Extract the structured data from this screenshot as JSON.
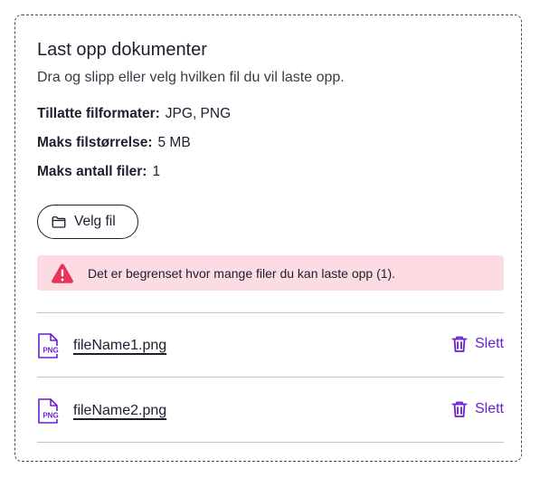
{
  "uploader": {
    "title": "Last opp dokumenter",
    "description": "Dra og slipp eller velg hvilken fil du vil laste opp.",
    "allowed_formats_label": "Tillatte filformater:",
    "allowed_formats_value": "JPG, PNG",
    "max_size_label": "Maks filstørrelse:",
    "max_size_value": "5 MB",
    "max_files_label": "Maks antall filer:",
    "max_files_value": "1",
    "choose_button_label": "Velg fil",
    "alert_message": "Det er begrenset hvor mange filer du kan laste opp (1).",
    "files": [
      {
        "name": "fileName1.png",
        "type_badge": "PNG",
        "delete_label": "Slett"
      },
      {
        "name": "fileName2.png",
        "type_badge": "PNG",
        "delete_label": "Slett"
      }
    ]
  },
  "icons": {
    "choose_button": "folder-icon",
    "alert": "warning-triangle-icon",
    "file": "png-file-icon",
    "delete": "trash-icon"
  },
  "colors": {
    "text": "#1f1d2e",
    "accent": "#6b1fd1",
    "alert_bg": "#fcdbe3",
    "alert_icon": "#e8345a",
    "border": "#4a4a52",
    "divider": "#c4c4c8"
  }
}
